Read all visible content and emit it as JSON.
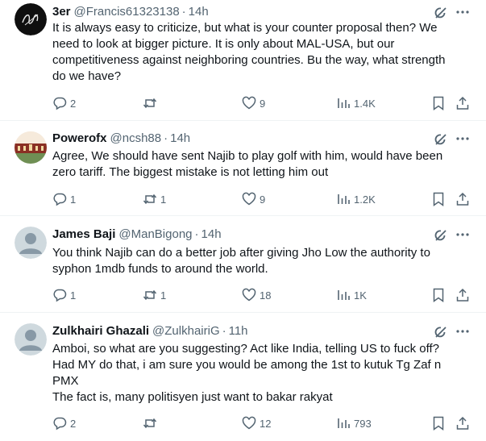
{
  "posts": [
    {
      "name": "3er",
      "handle": "@Francis61323138",
      "separator": "·",
      "time": "14h",
      "text": "It is always easy to criticize, but what is your counter proposal then? We\nneed to look at bigger picture. It is only about MAL-USA, but our\ncompetitiveness against neighboring countries. Bu the way, what strength\ndo we have?",
      "replies": "2",
      "reposts": "",
      "likes": "9",
      "views": "1.4K",
      "avatar_icon": "signature-logo-icon"
    },
    {
      "name": "Powerofx",
      "handle": "@ncsh88",
      "separator": "·",
      "time": "14h",
      "text": "Agree, We should have sent Najib to play golf with him, would have been\nzero tariff. The biggest mistake is not letting him out",
      "replies": "1",
      "reposts": "1",
      "likes": "9",
      "views": "1.2K",
      "avatar_icon": "building-photo-icon"
    },
    {
      "name": "James Baji",
      "handle": "@ManBigong",
      "separator": "·",
      "time": "14h",
      "text": "You think Najib can do a better job after giving Jho Low the authority to\nsyphon 1mdb funds to around the world.",
      "replies": "1",
      "reposts": "1",
      "likes": "18",
      "views": "1K",
      "avatar_icon": "default-person-icon"
    },
    {
      "name": "Zulkhairi Ghazali",
      "handle": "@ZulkhairiG",
      "separator": "·",
      "time": "11h",
      "text": "Amboi, so what are you suggesting? Act like India, telling US to fuck off?\nHad MY do that, i am sure you would be among the 1st to kutuk Tg Zaf n\nPMX\nThe fact is, many politisyen just want to bakar rakyat",
      "replies": "2",
      "reposts": "",
      "likes": "12",
      "views": "793",
      "avatar_icon": "default-person-icon"
    }
  ],
  "colors": {
    "text": "#0f1419",
    "secondary": "#536471",
    "divider": "#eff3f4"
  },
  "icons": [
    "grok-icon",
    "more-icon",
    "reply-icon",
    "repost-icon",
    "like-icon",
    "views-icon",
    "bookmark-icon",
    "share-icon"
  ]
}
